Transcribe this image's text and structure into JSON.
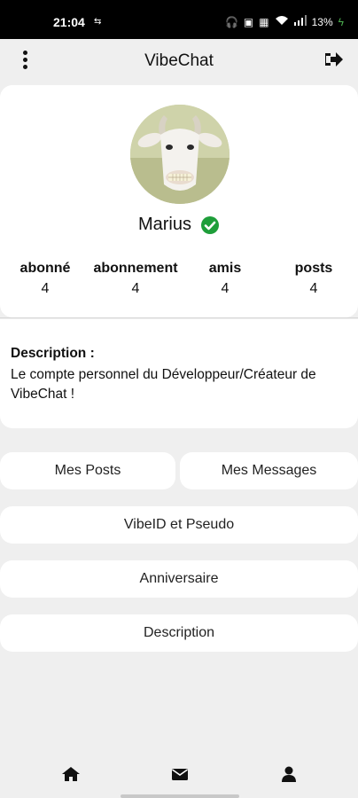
{
  "status_bar": {
    "time": "21:04",
    "battery": "13%"
  },
  "app": {
    "title": "VibeChat"
  },
  "profile": {
    "name": "Marius",
    "verified": true,
    "stats": [
      {
        "label": "abonné",
        "value": "4"
      },
      {
        "label": "abonnement",
        "value": "4"
      },
      {
        "label": "amis",
        "value": "4"
      },
      {
        "label": "posts",
        "value": "4"
      }
    ],
    "description_title": "Description :",
    "description_text": "Le compte personnel du Développeur/Créateur de VibeChat !"
  },
  "buttons": {
    "my_posts": "Mes Posts",
    "my_messages": "Mes Messages",
    "vibeid": "VibeID et Pseudo",
    "birthday": "Anniversaire",
    "description": "Description"
  },
  "nav": {
    "items": [
      "home-icon",
      "mail-icon",
      "person-icon"
    ]
  },
  "colors": {
    "verified": "#1e9e3a",
    "card": "#ffffff",
    "background": "#efefef",
    "status_bar": "#000000"
  }
}
